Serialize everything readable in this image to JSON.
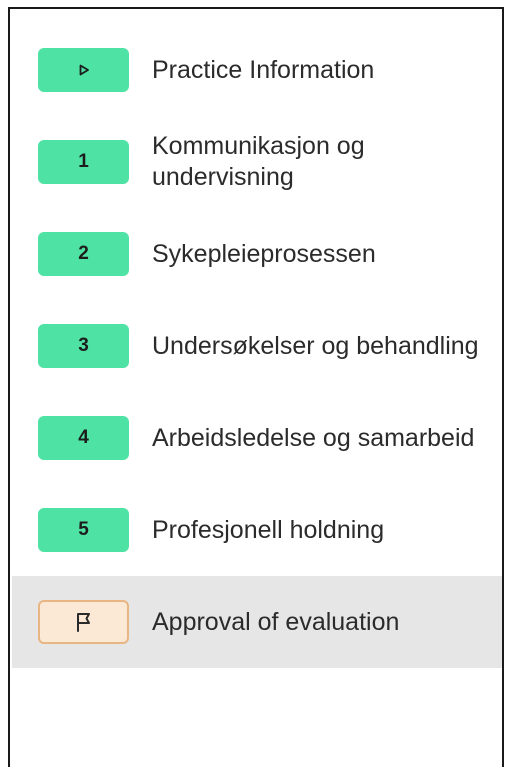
{
  "nav": {
    "items": [
      {
        "badge": "",
        "icon": "play-outline-icon",
        "label": "Practice Information"
      },
      {
        "badge": "1",
        "label": "Kommunikasjon og undervisning"
      },
      {
        "badge": "2",
        "label": "Sykepleieprosessen"
      },
      {
        "badge": "3",
        "label": "Undersøkelser og behandling"
      },
      {
        "badge": "4",
        "label": "Arbeidsledelse og samarbeid"
      },
      {
        "badge": "5",
        "label": "Profesjonell holdning"
      },
      {
        "badge": "",
        "icon": "flag-icon",
        "label": "Approval of evaluation",
        "active": true
      }
    ]
  },
  "colors": {
    "badge_green": "#4ee3a5",
    "approval_badge_bg": "#fbe9d6",
    "approval_badge_border": "#e8b682",
    "active_row_bg": "#e6e6e6"
  }
}
